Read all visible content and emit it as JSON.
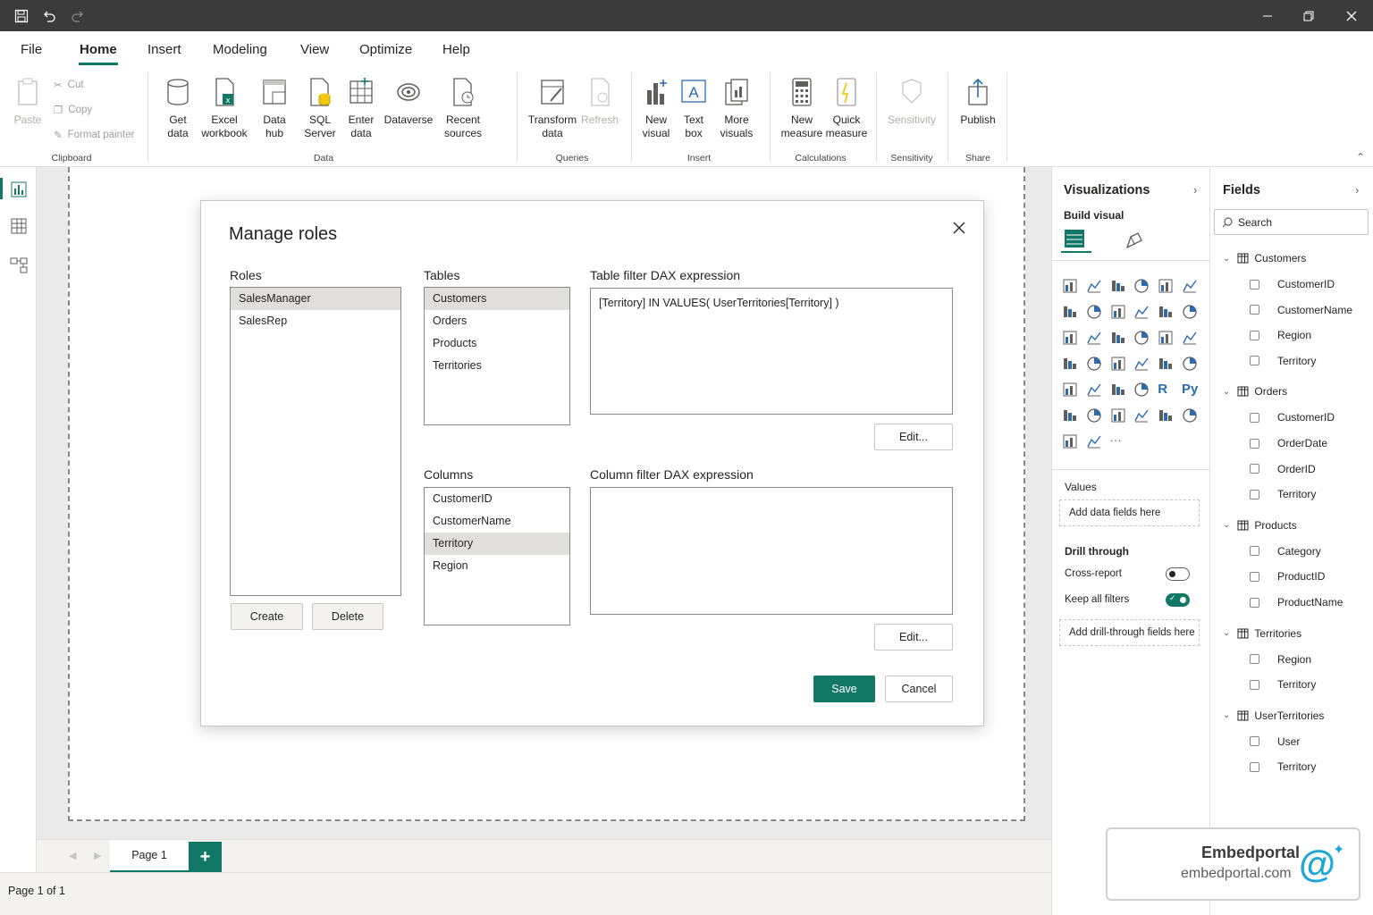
{
  "menu": {
    "file": "File",
    "home": "Home",
    "insert": "Insert",
    "modeling": "Modeling",
    "view": "View",
    "optimize": "Optimize",
    "help": "Help"
  },
  "ribbon": {
    "paste": "Paste",
    "cut": "Cut",
    "copy": "Copy",
    "format_painter": "Format painter",
    "clipboard_group": "Clipboard",
    "get_data": "Get data",
    "excel_workbook": "Excel workbook",
    "data_hub": "Data hub",
    "sql_server": "SQL Server",
    "enter_data": "Enter data",
    "dataverse": "Dataverse",
    "recent_sources": "Recent sources",
    "data_group": "Data",
    "transform_data": "Transform data",
    "refresh": "Refresh",
    "queries_group": "Queries",
    "new_visual": "New visual",
    "text_box": "Text box",
    "more_visuals": "More visuals",
    "insert_group": "Insert",
    "new_measure": "New measure",
    "quick_measure": "Quick measure",
    "calculations_group": "Calculations",
    "sensitivity": "Sensitivity",
    "sensitivity_group": "Sensitivity",
    "publish": "Publish",
    "share_group": "Share"
  },
  "dialog": {
    "title": "Manage roles",
    "roles_label": "Roles",
    "roles": [
      "SalesManager",
      "SalesRep"
    ],
    "tables_label": "Tables",
    "tables": [
      "Customers",
      "Orders",
      "Products",
      "Territories"
    ],
    "table_filter_label": "Table filter DAX expression",
    "table_filter_value": "[Territory]  IN  VALUES(  UserTerritories[Territory]  )",
    "columns_label": "Columns",
    "columns": [
      "CustomerID",
      "CustomerName",
      "Territory",
      "Region"
    ],
    "column_filter_label": "Column filter DAX expression",
    "column_filter_value": "",
    "edit": "Edit...",
    "create": "Create",
    "delete": "Delete",
    "save": "Save",
    "cancel": "Cancel"
  },
  "pages": {
    "tab": "Page 1",
    "add": "+"
  },
  "status": {
    "page_count": "Page 1 of 1"
  },
  "visualizations": {
    "title": "Visualizations",
    "build_visual": "Build visual",
    "values": "Values",
    "add_data": "Add data fields here",
    "drill_through": "Drill through",
    "cross_report": "Cross-report",
    "keep_all_filters": "Keep all filters",
    "add_drill": "Add drill-through fields here",
    "cross_report_on": false,
    "keep_all_filters_on": true,
    "more": "···",
    "r": "R",
    "py": "Py"
  },
  "fields": {
    "title": "Fields",
    "search_placeholder": "Search",
    "tables": [
      {
        "name": "Customers",
        "fields": [
          "CustomerID",
          "CustomerName",
          "Region",
          "Territory"
        ]
      },
      {
        "name": "Orders",
        "fields": [
          "CustomerID",
          "OrderDate",
          "OrderID",
          "Territory"
        ]
      },
      {
        "name": "Products",
        "fields": [
          "Category",
          "ProductID",
          "ProductName"
        ]
      },
      {
        "name": "Territories",
        "fields": [
          "Region",
          "Territory"
        ]
      },
      {
        "name": "UserTerritories",
        "fields": [
          "User",
          "Territory"
        ]
      }
    ]
  },
  "watermark": {
    "brand": "Embedportal",
    "domain": "embedportal.com",
    "symbol": "@"
  },
  "colors": {
    "accent": "#117865",
    "titlebar": "#3b3b3b",
    "blue_icon": "#2b6cb0"
  }
}
